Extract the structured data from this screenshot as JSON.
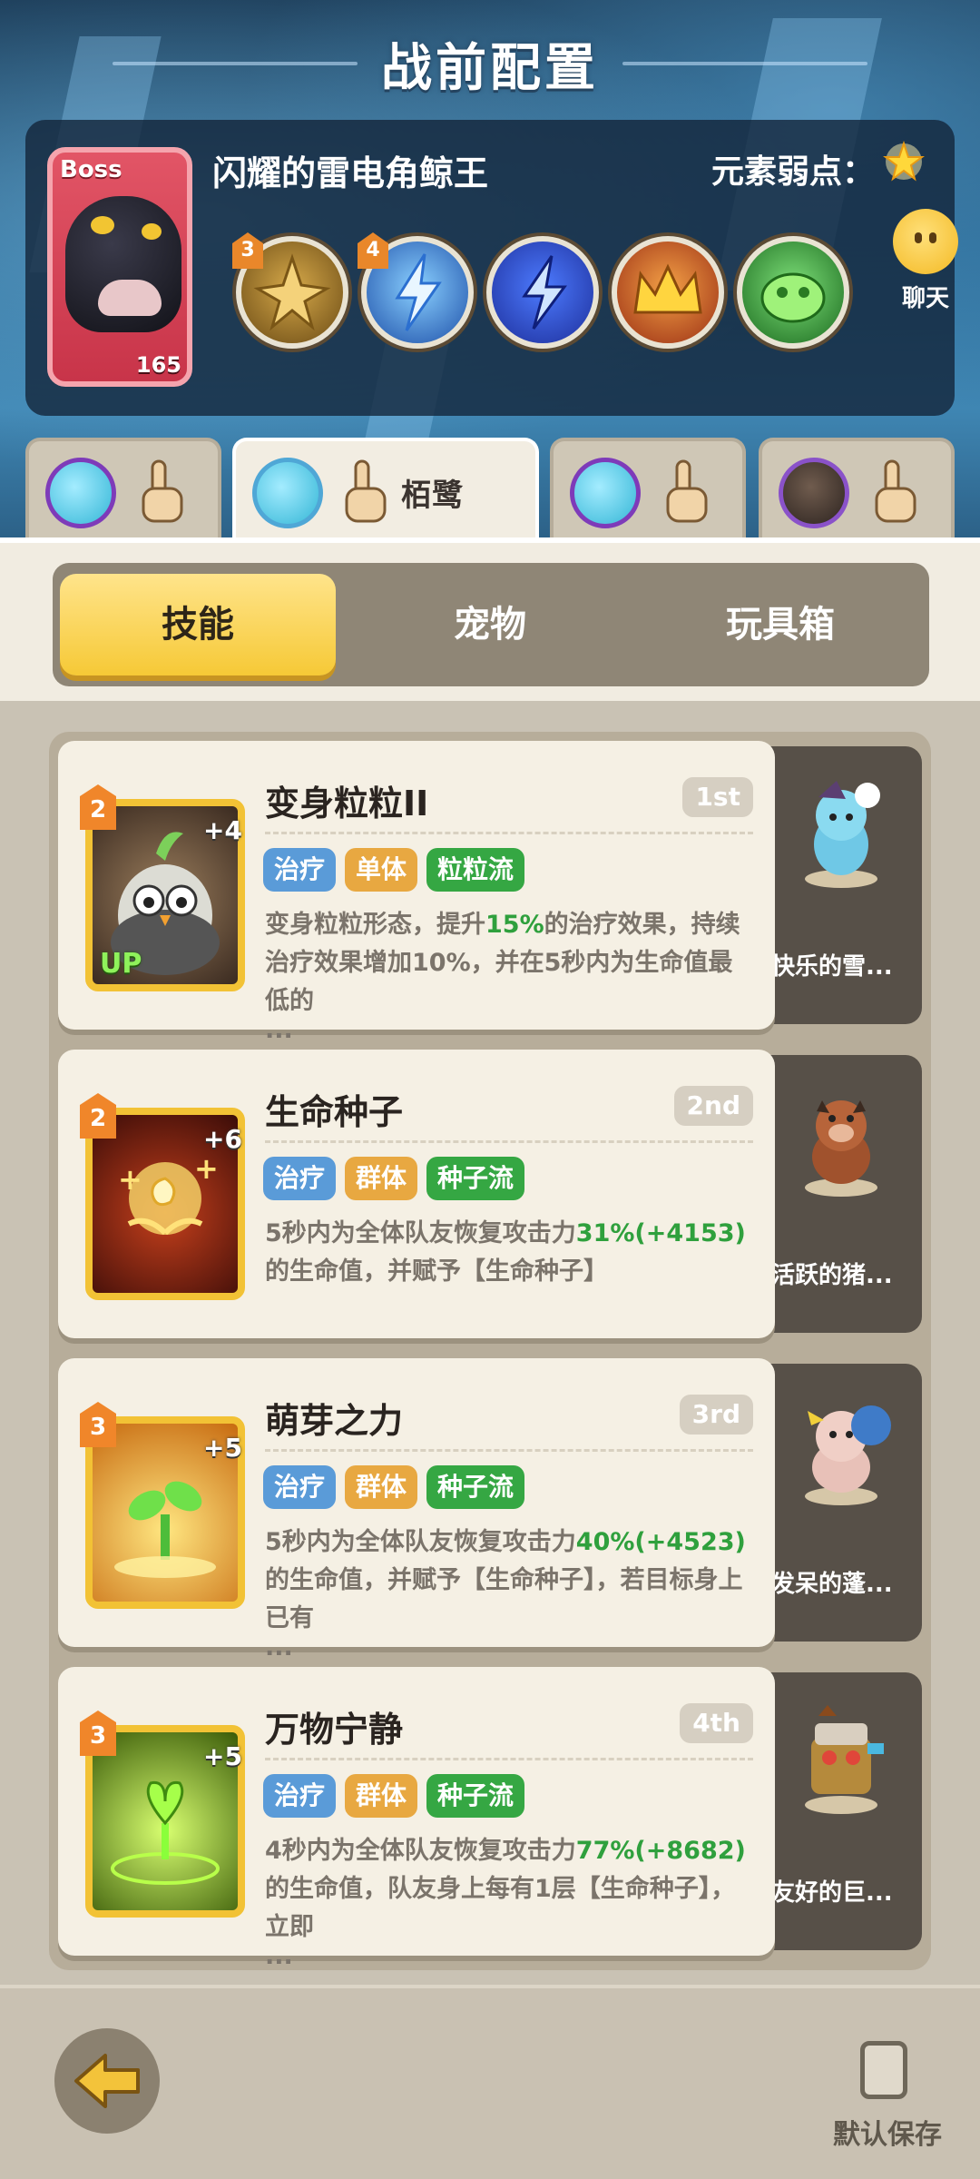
{
  "header": {
    "title": "战前配置"
  },
  "boss": {
    "tag": "Boss",
    "level": "165",
    "name": "闪耀的雷电角鲸王",
    "weakness_label": "元素弱点：",
    "weakness_icon": "star-icon",
    "skills": [
      {
        "icon": "golden-spikes-icon",
        "badge": "3"
      },
      {
        "icon": "blue-lightning-icon",
        "badge": "4"
      },
      {
        "icon": "lightning-bolt-icon",
        "badge": ""
      },
      {
        "icon": "golden-crown-icon",
        "badge": ""
      },
      {
        "icon": "green-slime-icon",
        "badge": ""
      }
    ]
  },
  "chat": {
    "label": "聊天"
  },
  "players": [
    {
      "name": ""
    },
    {
      "name": "栢鹭"
    },
    {
      "name": ""
    },
    {
      "name": ""
    }
  ],
  "categories": [
    {
      "label": "技能"
    },
    {
      "label": "宠物"
    },
    {
      "label": "玩具箱"
    }
  ],
  "skills": [
    {
      "rank": "2",
      "plus": "+4",
      "up": "UP",
      "name": "变身粒粒II",
      "order": "1st",
      "tags": [
        "治疗",
        "单体",
        "粒粒流"
      ],
      "desc_a": "变身粒粒形态，提升",
      "desc_hl": "15%",
      "desc_b": "的治疗效果，持续治疗效果增加10%，并在5秒内为生命值最低的",
      "dots": "...",
      "pet_name": "快乐的雪..."
    },
    {
      "rank": "2",
      "plus": "+6",
      "up": "",
      "name": "生命种子",
      "order": "2nd",
      "tags": [
        "治疗",
        "群体",
        "种子流"
      ],
      "desc_a": "5秒内为全体队友恢复攻击力",
      "desc_hl": "31%(+4153)",
      "desc_b": "的生命值，并赋予【生命种子】",
      "dots": "",
      "pet_name": "活跃的猪..."
    },
    {
      "rank": "3",
      "plus": "+5",
      "up": "",
      "name": "萌芽之力",
      "order": "3rd",
      "tags": [
        "治疗",
        "群体",
        "种子流"
      ],
      "desc_a": "5秒内为全体队友恢复攻击力",
      "desc_hl": "40%(+4523)",
      "desc_b": "的生命值，并赋予【生命种子】，若目标身上已有",
      "dots": "...",
      "pet_name": "发呆的蓬..."
    },
    {
      "rank": "3",
      "plus": "+5",
      "up": "",
      "name": "万物宁静",
      "order": "4th",
      "tags": [
        "治疗",
        "群体",
        "种子流"
      ],
      "desc_a": "4秒内为全体队友恢复攻击力",
      "desc_hl": "77%(+8682)",
      "desc_b": "的生命值，队友身上每有1层【生命种子】，立即",
      "dots": "...",
      "pet_name": "友好的巨..."
    }
  ],
  "footer": {
    "save_label": "默认保存"
  },
  "colors": {
    "accent": "#f6c936",
    "heal_tag": "#5a9bd8",
    "type_tag": "#e8a841",
    "flow_tag": "#35a743"
  }
}
